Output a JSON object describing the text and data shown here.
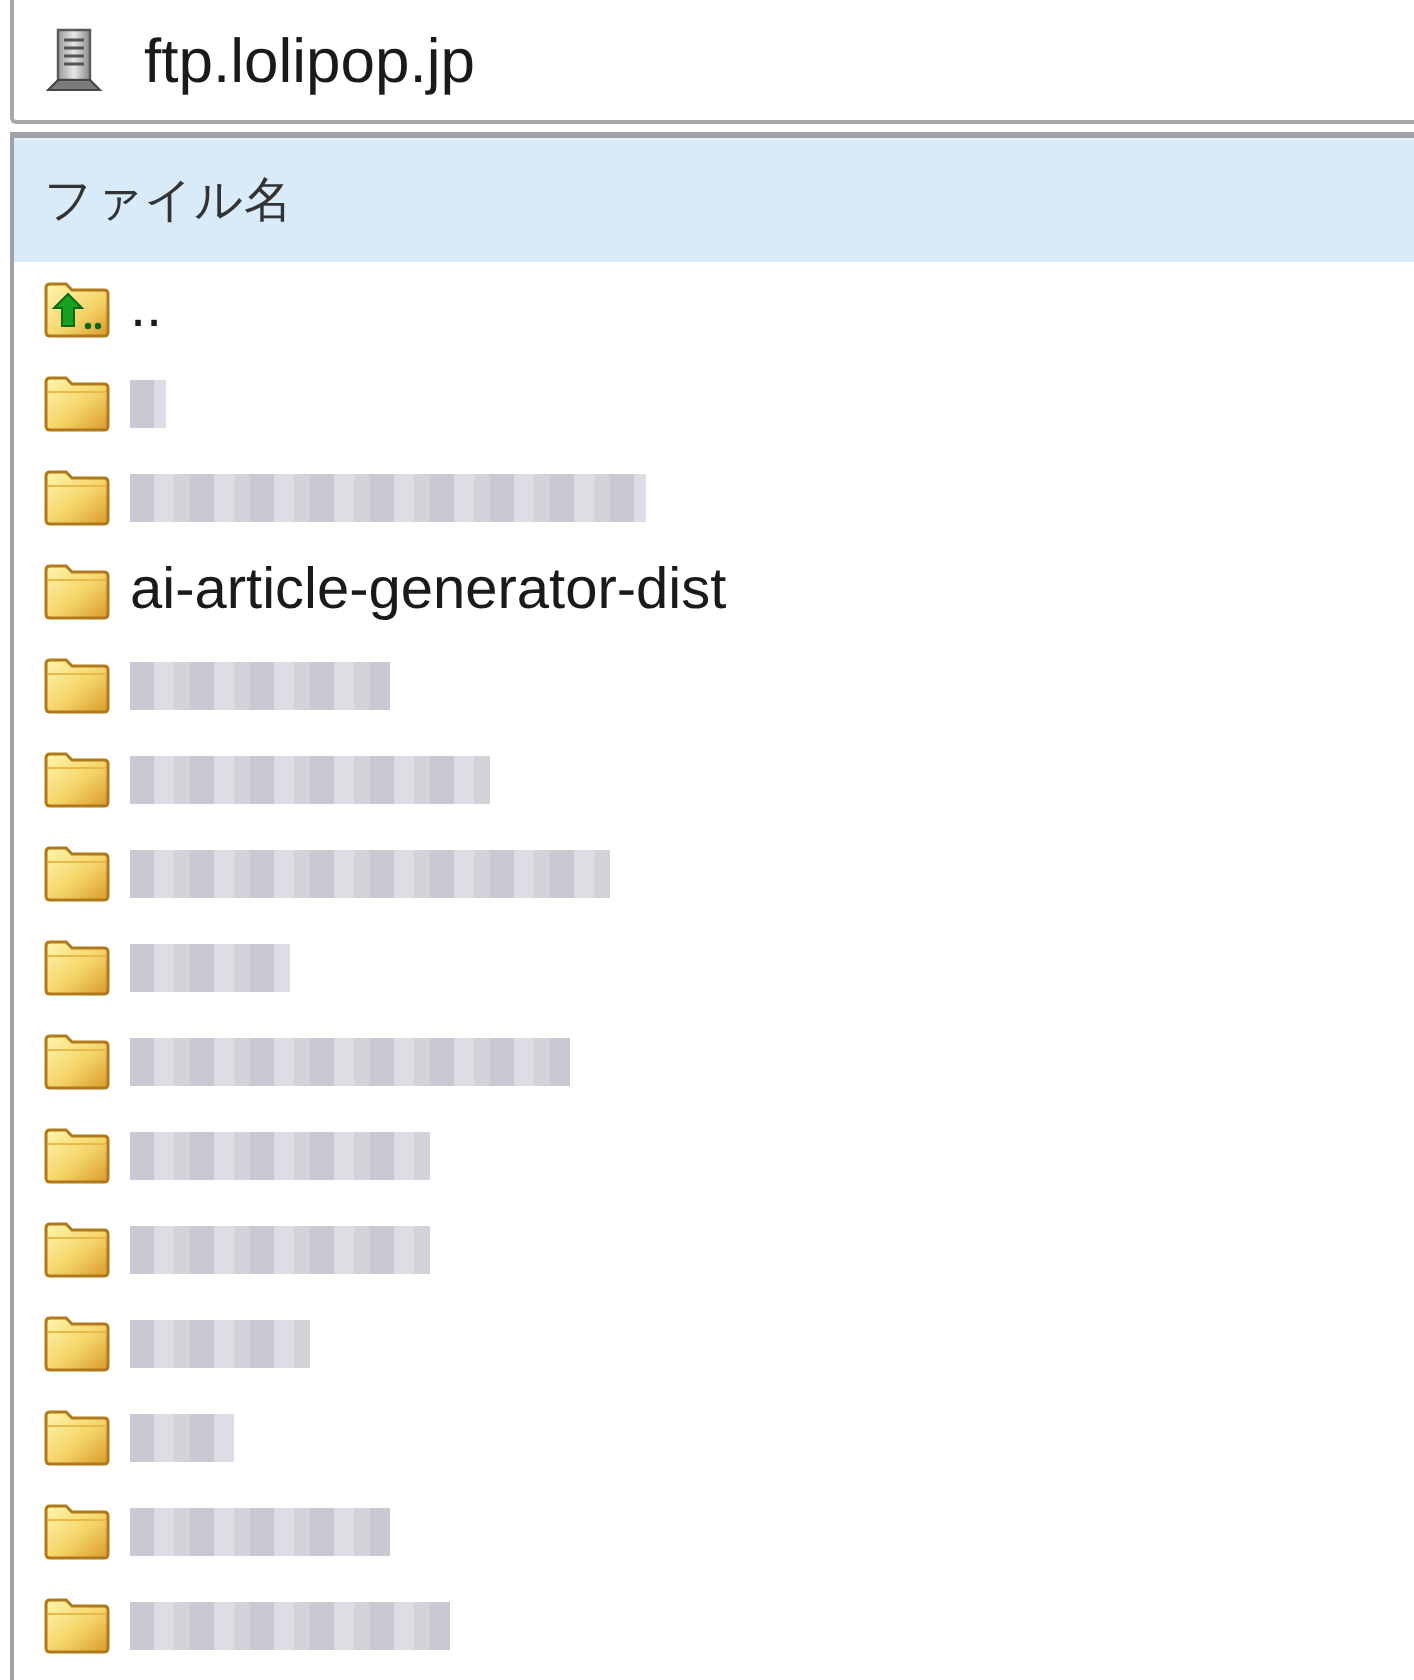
{
  "address_bar": {
    "host": "ftp.lolipop.jp"
  },
  "file_list": {
    "columns": [
      {
        "label": "ファイル名"
      }
    ],
    "rows": [
      {
        "kind": "parent",
        "name": ".."
      },
      {
        "kind": "redacted"
      },
      {
        "kind": "redacted"
      },
      {
        "kind": "folder",
        "name": "ai-article-generator-dist"
      },
      {
        "kind": "redacted"
      },
      {
        "kind": "redacted"
      },
      {
        "kind": "redacted"
      },
      {
        "kind": "redacted"
      },
      {
        "kind": "redacted"
      },
      {
        "kind": "redacted"
      },
      {
        "kind": "redacted"
      },
      {
        "kind": "redacted"
      },
      {
        "kind": "redacted"
      },
      {
        "kind": "redacted"
      },
      {
        "kind": "redacted"
      }
    ]
  }
}
